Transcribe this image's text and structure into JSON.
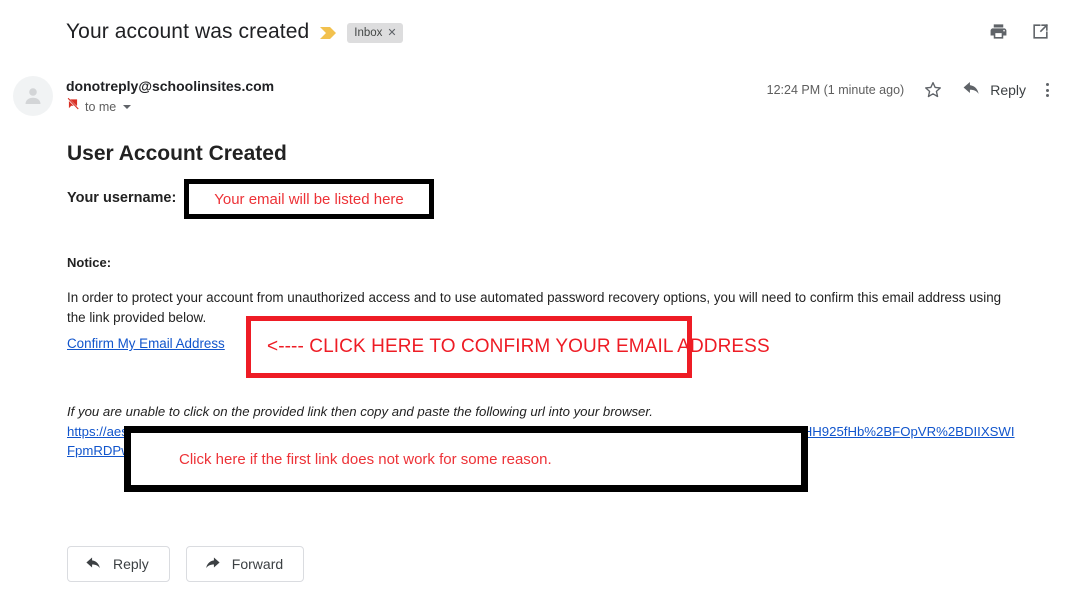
{
  "header": {
    "subject": "Your account was created",
    "important_marker_icon": "important-chevron-icon",
    "label_chip": "Inbox",
    "label_chip_remove": "✕",
    "print_icon": "print-icon",
    "popout_icon": "open-in-new-window-icon"
  },
  "sender": {
    "avatar_icon": "person-avatar-icon",
    "address": "donotreply@schoolinsites.com",
    "recipient_icon": "no-reply-icon",
    "recipient": "to me",
    "details_caret_icon": "chevron-down-icon",
    "timestamp": "12:24 PM (1 minute ago)",
    "star_icon": "star-outline-icon",
    "reply_icon": "reply-arrow-icon",
    "reply_label": "Reply",
    "more_icon": "more-vertical-icon"
  },
  "body": {
    "heading": "User Account Created",
    "username_label": "Your username:",
    "notice_label": "Notice:",
    "notice_text": "In order to protect your account from unauthorized access and to use automated password recovery options, you will need to confirm this email address using the link provided below.",
    "confirm_link": "Confirm My Email Address",
    "fallback_note": "If you are unable to click on the provided link then copy and paste the following url into your browser.",
    "url": "https://aes.schoolinsites.com/auth/userprofile/AccountConfirmEmail?userId=Z-1183c-4416-a694-791j8LdE-4808&code=CfDJ8HH925fHb%2BFOpVR%2BDIIXSWIFpmRDPwHLKkXJUvzQNreY2HsU%2Bq1v7NJfxS%2FRHbOEiVnKMqZjkBTpARmWXZQpgH1YsSoiCvoNTWre%2BBpA"
  },
  "annotations": {
    "username_box": "Your email will be listed here",
    "confirm_box": "<---- CLICK HERE TO CONFIRM YOUR EMAIL ADDRESS",
    "url_box": "Click here if the first link does not work for some reason.",
    "black_color": "#000000",
    "red_color": "#ee1c25",
    "red_text_color": "#ed3237"
  },
  "footer": {
    "reply_label": "Reply",
    "reply_icon": "reply-arrow-icon",
    "forward_label": "Forward",
    "forward_icon": "forward-arrow-icon"
  }
}
